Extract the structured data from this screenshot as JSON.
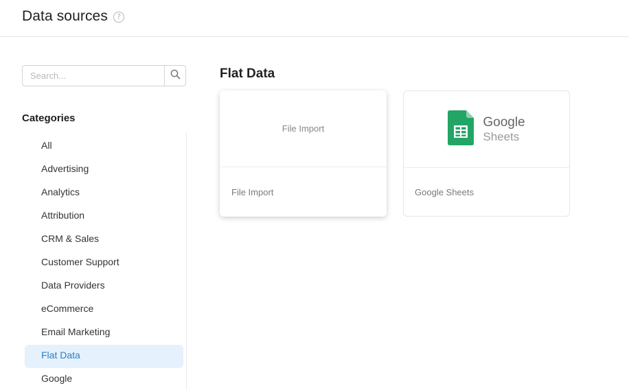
{
  "header": {
    "title": "Data sources",
    "help_glyph": "?"
  },
  "search": {
    "placeholder": "Search..."
  },
  "categories": {
    "title": "Categories",
    "items": [
      {
        "label": "All",
        "active": false
      },
      {
        "label": "Advertising",
        "active": false
      },
      {
        "label": "Analytics",
        "active": false
      },
      {
        "label": "Attribution",
        "active": false
      },
      {
        "label": "CRM & Sales",
        "active": false
      },
      {
        "label": "Customer Support",
        "active": false
      },
      {
        "label": "Data Providers",
        "active": false
      },
      {
        "label": "eCommerce",
        "active": false
      },
      {
        "label": "Email Marketing",
        "active": false
      },
      {
        "label": "Flat Data",
        "active": true
      },
      {
        "label": "Google",
        "active": false
      }
    ]
  },
  "main": {
    "section_title": "Flat Data",
    "cards": [
      {
        "image_text": "File Import",
        "label": "File Import"
      },
      {
        "logo_brand": "Google",
        "logo_product": "Sheets",
        "label": "Google Sheets",
        "icon": "google-sheets-icon"
      }
    ]
  },
  "colors": {
    "accent": "#2d7ec4",
    "active_bg": "#e5f2fd",
    "sheets_green": "#23a566"
  }
}
